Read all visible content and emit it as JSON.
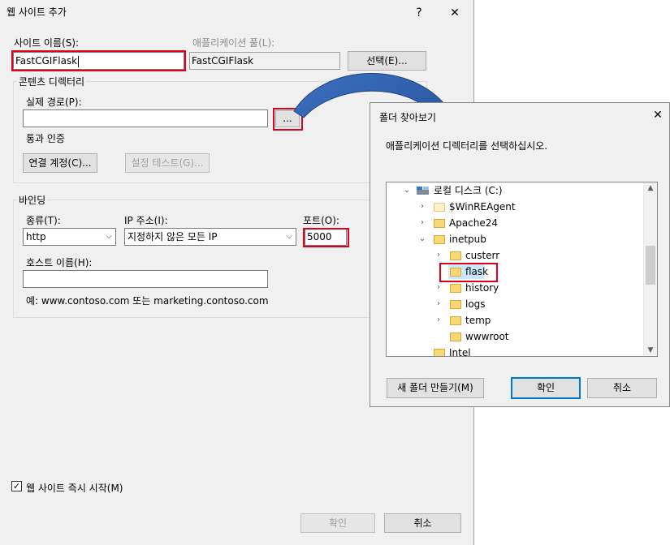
{
  "main_dialog": {
    "title": "웹 사이트 추가",
    "help_button": "?",
    "close_button": "✕",
    "site_name_label": "사이트 이름(S):",
    "site_name_value": "FastCGIFlask",
    "app_pool_label": "애플리케이션 풀(L):",
    "app_pool_value": "FastCGIFlask",
    "select_button": "선택(E)...",
    "content_directory_group": "콘텐츠 디렉터리",
    "physical_path_label": "실제 경로(P):",
    "physical_path_value": "",
    "browse_button": "...",
    "pass_through_auth_label": "통과 인증",
    "connect_as_button": "연결 계정(C)...",
    "test_settings_button": "설정 테스트(G)...",
    "binding_group": "바인딩",
    "type_label": "종류(T):",
    "type_value": "http",
    "ip_label": "IP 주소(I):",
    "ip_value": "지정하지 않은 모든 IP",
    "port_label": "포트(O):",
    "port_value": "5000",
    "host_name_label": "호스트 이름(H):",
    "host_name_value": "",
    "example_text": "예: www.contoso.com 또는 marketing.contoso.com",
    "start_immediately_label": "웹 사이트 즉시 시작(M)",
    "start_immediately_checked": true,
    "ok_button": "확인",
    "cancel_button": "취소"
  },
  "folder_dialog": {
    "title": "폴더 찾아보기",
    "close_button": "✕",
    "instruction": "애플리케이션 디렉터리를 선택하십시오.",
    "tree": [
      {
        "label": "로컬 디스크 (C:)",
        "icon": "drive-icon",
        "expander": "expanded"
      },
      {
        "label": "$WinREAgent",
        "icon": "folder-icon",
        "expander": "collapsed"
      },
      {
        "label": "Apache24",
        "icon": "folder-icon",
        "expander": "collapsed"
      },
      {
        "label": "inetpub",
        "icon": "folder-icon",
        "expander": "expanded"
      },
      {
        "label": "custerr",
        "icon": "folder-icon",
        "expander": "collapsed"
      },
      {
        "label": "flask",
        "icon": "folder-icon",
        "expander": "none",
        "selected": true
      },
      {
        "label": "history",
        "icon": "folder-icon",
        "expander": "collapsed"
      },
      {
        "label": "logs",
        "icon": "folder-icon",
        "expander": "collapsed"
      },
      {
        "label": "temp",
        "icon": "folder-icon",
        "expander": "collapsed"
      },
      {
        "label": "wwwroot",
        "icon": "folder-icon",
        "expander": "none"
      },
      {
        "label": "Intel",
        "icon": "folder-icon",
        "expander": "none"
      }
    ],
    "new_folder_button": "새 폴더 만들기(M)",
    "ok_button": "확인",
    "cancel_button": "취소"
  },
  "colors": {
    "highlight_red": "#e0001b",
    "arrow_blue": "#2f5faa",
    "selection_blue": "#cce8ff",
    "dialog_bg": "#f0f0f0"
  }
}
